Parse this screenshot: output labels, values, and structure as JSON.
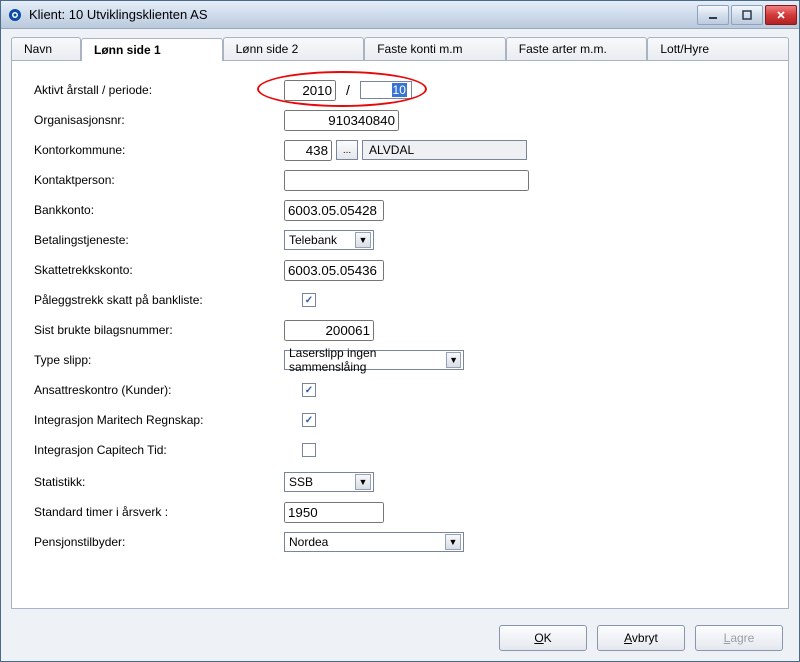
{
  "window": {
    "title": "Klient:  10  Utviklingsklienten AS"
  },
  "tabs": [
    {
      "label": "Navn"
    },
    {
      "label": "Lønn side 1"
    },
    {
      "label": "Lønn side 2"
    },
    {
      "label": "Faste konti m.m"
    },
    {
      "label": "Faste arter m.m."
    },
    {
      "label": "Lott/Hyre"
    }
  ],
  "form": {
    "aktivt_label": "Aktivt årstall / periode:",
    "aktivt_year": "2010",
    "aktivt_period": "10",
    "orgnr_label": "Organisasjonsnr:",
    "orgnr": "910340840",
    "kontorkommune_label": "Kontorkommune:",
    "kontorkommune_code": "438",
    "kontorkommune_name": "ALVDAL",
    "lookup_btn": "...",
    "kontaktperson_label": "Kontaktperson:",
    "kontaktperson": "",
    "bankkonto_label": "Bankkonto:",
    "bankkonto": "6003.05.05428",
    "betalingstjeneste_label": "Betalingstjeneste:",
    "betalingstjeneste": "Telebank",
    "skattetrekkskonto_label": "Skattetrekkskonto:",
    "skattetrekkskonto": "6003.05.05436",
    "paleggstrekk_label": "Påleggstrekk skatt på bankliste:",
    "paleggstrekk_checked": true,
    "bilagsnr_label": "Sist brukte bilagsnummer:",
    "bilagsnr": "200061",
    "type_slipp_label": "Type slipp:",
    "type_slipp": "Laserslipp ingen sammenslåing",
    "ansattreskontro_label": "Ansattreskontro (Kunder):",
    "ansattreskontro_checked": true,
    "int_maritech_label": "Integrasjon Maritech Regnskap:",
    "int_maritech_checked": true,
    "int_capitech_label": "Integrasjon Capitech Tid:",
    "int_capitech_checked": false,
    "statistikk_label": "Statistikk:",
    "statistikk": "SSB",
    "std_timer_label": "Standard timer i årsverk :",
    "std_timer": "1950",
    "pensjon_label": "Pensjonstilbyder:",
    "pensjon": "Nordea"
  },
  "buttons": {
    "ok": "OK",
    "avbryt": "Avbryt",
    "lagre": "Lagre"
  }
}
